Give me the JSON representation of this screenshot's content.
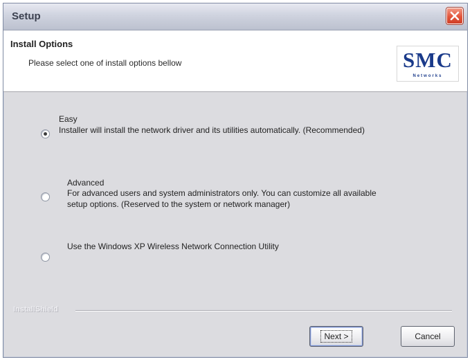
{
  "window": {
    "title": "Setup"
  },
  "header": {
    "title": "Install Options",
    "subtitle": "Please select one of install options bellow",
    "logo_main": "SMC",
    "logo_sub": "Networks"
  },
  "options": [
    {
      "title": "Easy",
      "description": "Installer will install the network driver and its utilities automatically. (Recommended)",
      "selected": true
    },
    {
      "title": "Advanced",
      "description_line1": "For advanced users and system administrators only.  You can customize all available",
      "description_line2": "setup options. (Reserved to the system or network manager)",
      "selected": false
    },
    {
      "title": "Use the Windows XP Wireless Network Connection Utility",
      "selected": false
    }
  ],
  "footer": {
    "brand": "InstallShield",
    "next_label": "Next >",
    "cancel_label": "Cancel"
  },
  "icons": {
    "close": "close-icon"
  },
  "colors": {
    "close_red": "#e3553b",
    "logo_blue": "#1a3a8a",
    "dialog_gray": "#dcdce0"
  }
}
